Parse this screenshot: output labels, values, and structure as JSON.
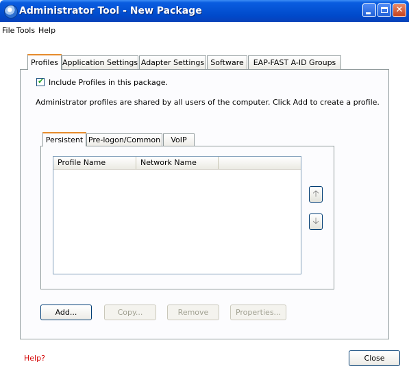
{
  "window": {
    "title": "Administrator Tool - New Package"
  },
  "menu": {
    "items": [
      "File",
      "Tools",
      "Help"
    ]
  },
  "tabs": [
    {
      "label": "Profiles",
      "active": true
    },
    {
      "label": "Application Settings",
      "active": false
    },
    {
      "label": "Adapter Settings",
      "active": false
    },
    {
      "label": "Software",
      "active": false
    },
    {
      "label": "EAP-FAST A-ID Groups",
      "active": false
    }
  ],
  "profiles": {
    "include_checkbox": {
      "label": "Include Profiles in this package.",
      "checked": true
    },
    "description": "Administrator profiles are shared by all users of the computer. Click Add to create a profile.",
    "inner_tabs": [
      {
        "label": "Persistent",
        "active": true
      },
      {
        "label": "Pre-logon/Common",
        "active": false
      },
      {
        "label": "VoIP",
        "active": false
      }
    ],
    "columns": [
      "Profile Name",
      "Network Name"
    ],
    "rows": [],
    "buttons": {
      "add": {
        "label": "Add...",
        "enabled": true
      },
      "copy": {
        "label": "Copy...",
        "enabled": false
      },
      "remove": {
        "label": "Remove",
        "enabled": false
      },
      "properties": {
        "label": "Properties...",
        "enabled": false
      }
    }
  },
  "footer": {
    "help_link": "Help?",
    "close_label": "Close"
  },
  "icons": {
    "up": "arrow-up-icon",
    "down": "arrow-down-icon",
    "app": "network-app-icon"
  },
  "colors": {
    "titlebar": "#0054e3",
    "tab_highlight": "#e68b2c",
    "help_link": "#d40000"
  }
}
